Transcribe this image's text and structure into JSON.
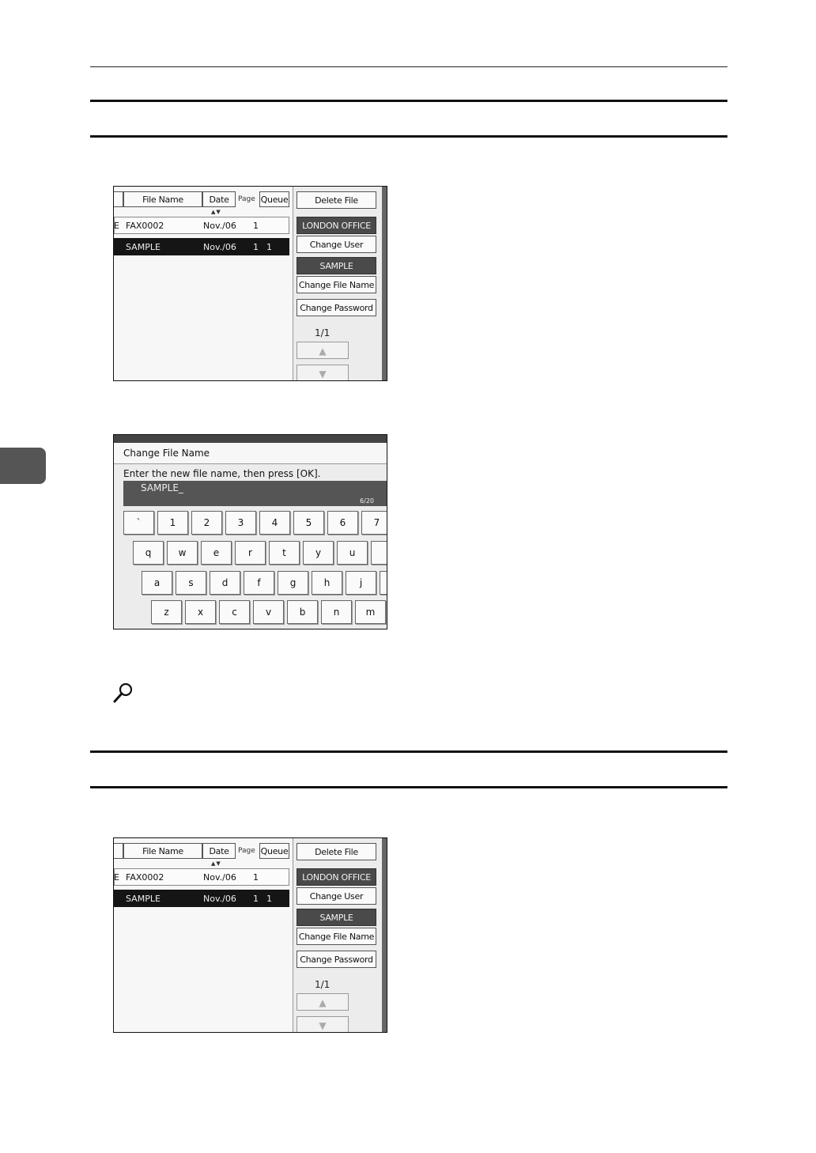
{
  "screen_top": {
    "headers": {
      "file_name": "File Name",
      "date": "Date",
      "page": "Page",
      "queue": "Queue"
    },
    "rows": [
      {
        "prefix": "E",
        "name": "FAX0002",
        "date": "Nov./06",
        "page": "1",
        "queue": "",
        "selected": false
      },
      {
        "prefix": "",
        "name": "SAMPLE",
        "date": "Nov./06",
        "page": "1",
        "queue": "1",
        "selected": true
      }
    ],
    "buttons": {
      "delete_file": "Delete File",
      "user_name_value": "LONDON OFFICE",
      "change_user_name": "Change User Name",
      "file_name_value": "SAMPLE",
      "change_file_name": "Change File Name",
      "change_password": "Change Password"
    },
    "page_count": "1/1"
  },
  "keyboard_dialog": {
    "title": "Change File Name",
    "instruction": "Enter the new file name, then press [OK].",
    "input_value": "SAMPLE_",
    "char_count": "6/20",
    "rows": [
      [
        "`",
        "1",
        "2",
        "3",
        "4",
        "5",
        "6",
        "7"
      ],
      [
        "q",
        "w",
        "e",
        "r",
        "t",
        "y",
        "u",
        ""
      ],
      [
        "a",
        "s",
        "d",
        "f",
        "g",
        "h",
        "j",
        ""
      ],
      [
        "z",
        "x",
        "c",
        "v",
        "b",
        "n",
        "m"
      ]
    ]
  },
  "screen_bottom": {
    "headers": {
      "file_name": "File Name",
      "date": "Date",
      "page": "Page",
      "queue": "Queue"
    },
    "rows": [
      {
        "prefix": "E",
        "name": "FAX0002",
        "date": "Nov./06",
        "page": "1",
        "queue": "",
        "selected": false
      },
      {
        "prefix": "",
        "name": "SAMPLE",
        "date": "Nov./06",
        "page": "1",
        "queue": "1",
        "selected": true
      }
    ],
    "buttons": {
      "delete_file": "Delete File",
      "user_name_value": "LONDON OFFICE",
      "change_user_name": "Change User Name",
      "file_name_value": "SAMPLE",
      "change_file_name": "Change File Name",
      "change_password": "Change Password"
    },
    "page_count": "1/1"
  },
  "icons": {
    "reference": "magnifier-icon",
    "scroll_up": "triangle-up-icon",
    "scroll_down": "triangle-down-icon"
  }
}
